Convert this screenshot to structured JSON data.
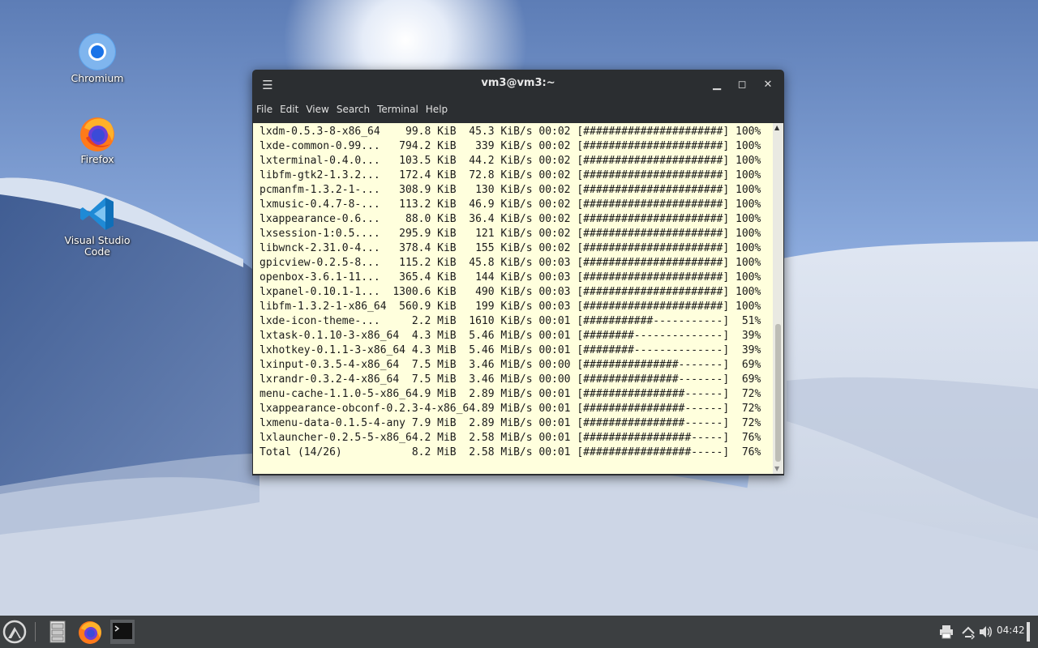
{
  "desktop": {
    "icons": [
      {
        "label": "Chromium"
      },
      {
        "label": "Firefox"
      },
      {
        "label": "Visual Studio Code"
      }
    ]
  },
  "window": {
    "title": "vm3@vm3:~",
    "menu": [
      "File",
      "Edit",
      "View",
      "Search",
      "Terminal",
      "Help"
    ],
    "terminal_lines": [
      "lxdm-0.5.3-8-x86_64    99.8 KiB  45.3 KiB/s 00:02 [######################] 100%",
      "lxde-common-0.99...   794.2 KiB   339 KiB/s 00:02 [######################] 100%",
      "lxterminal-0.4.0...   103.5 KiB  44.2 KiB/s 00:02 [######################] 100%",
      "libfm-gtk2-1.3.2...   172.4 KiB  72.8 KiB/s 00:02 [######################] 100%",
      "pcmanfm-1.3.2-1-...   308.9 KiB   130 KiB/s 00:02 [######################] 100%",
      "lxmusic-0.4.7-8-...   113.2 KiB  46.9 KiB/s 00:02 [######################] 100%",
      "lxappearance-0.6...    88.0 KiB  36.4 KiB/s 00:02 [######################] 100%",
      "lxsession-1:0.5....   295.9 KiB   121 KiB/s 00:02 [######################] 100%",
      "libwnck-2.31.0-4...   378.4 KiB   155 KiB/s 00:02 [######################] 100%",
      "gpicview-0.2.5-8...   115.2 KiB  45.8 KiB/s 00:03 [######################] 100%",
      "openbox-3.6.1-11...   365.4 KiB   144 KiB/s 00:03 [######################] 100%",
      "lxpanel-0.10.1-1...  1300.6 KiB   490 KiB/s 00:03 [######################] 100%",
      "libfm-1.3.2-1-x86_64  560.9 KiB   199 KiB/s 00:03 [######################] 100%",
      "lxde-icon-theme-...     2.2 MiB  1610 KiB/s 00:01 [###########-----------]  51%",
      "lxtask-0.1.10-3-x86_64  4.3 MiB  5.46 MiB/s 00:01 [########--------------]  39%",
      "lxhotkey-0.1.1-3-x86_64 4.3 MiB  5.46 MiB/s 00:01 [########--------------]  39%",
      "lxinput-0.3.5-4-x86_64  7.5 MiB  3.46 MiB/s 00:00 [###############-------]  69%",
      "lxrandr-0.3.2-4-x86_64  7.5 MiB  3.46 MiB/s 00:00 [###############-------]  69%",
      "menu-cache-1.1.0-5-x86_64.9 MiB  2.89 MiB/s 00:01 [################------]  72%",
      "lxappearance-obconf-0.2.3-4-x86_64.89 MiB/s 00:01 [################------]  72%",
      "lxmenu-data-0.1.5-4-any 7.9 MiB  2.89 MiB/s 00:01 [################------]  72%",
      "lxlauncher-0.2.5-5-x86_64.2 MiB  2.58 MiB/s 00:01 [#################-----]  76%",
      "Total (14/26)           8.2 MiB  2.58 MiB/s 00:01 [#################-----]  76%"
    ]
  },
  "taskbar": {
    "clock": "04:42"
  },
  "colors": {
    "terminal_bg": "#ffffdd",
    "window_chrome": "#2b2e31",
    "taskbar_bg": "#3c3f41"
  }
}
